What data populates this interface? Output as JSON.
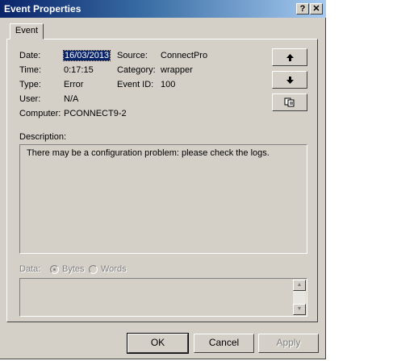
{
  "window": {
    "title": "Event Properties",
    "help_btn": "?",
    "close_btn": "✕"
  },
  "tabs": [
    {
      "label": "Event"
    }
  ],
  "fields": {
    "date_label": "Date:",
    "date_value": "16/03/2013",
    "time_label": "Time:",
    "time_value": "0:17:15",
    "type_label": "Type:",
    "type_value": "Error",
    "user_label": "User:",
    "user_value": "N/A",
    "computer_label": "Computer:",
    "computer_value": "PCONNECT9-2",
    "source_label": "Source:",
    "source_value": "ConnectPro",
    "category_label": "Category:",
    "category_value": "wrapper",
    "eventid_label": "Event ID:",
    "eventid_value": "100"
  },
  "nav_buttons": {
    "up": "🡅",
    "down": "🡇",
    "copy": "copy-icon"
  },
  "description": {
    "label": "Description:",
    "text": "There may be a configuration problem: please check the logs."
  },
  "data": {
    "label": "Data:",
    "bytes_label": "Bytes",
    "words_label": "Words",
    "selected": "Bytes"
  },
  "buttons": {
    "ok": "OK",
    "cancel": "Cancel",
    "apply": "Apply"
  }
}
